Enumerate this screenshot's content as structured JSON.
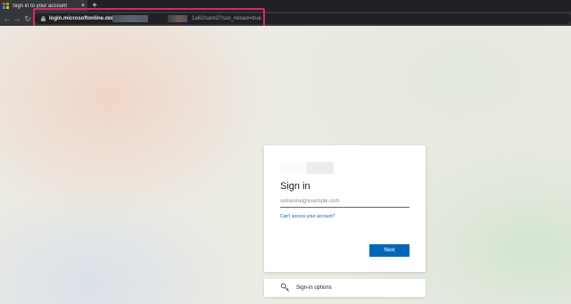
{
  "browser": {
    "tab_title": "Sign in to your account",
    "tab_close": "×",
    "new_tab": "+",
    "nav": {
      "back": "←",
      "forward": "→",
      "reload": "↻"
    },
    "url_host": "login.microsoftonline.com/",
    "url_path_start": "bc",
    "url_path_end": "1a62/saml2?sso_reload=true",
    "highlight_color": "#e0245e"
  },
  "signin": {
    "title": "Sign in",
    "email_placeholder": "someone@example.com",
    "help_link": "Can't access your account?",
    "next_label": "Next",
    "accent_color": "#0067b8"
  },
  "options": {
    "label": "Sign-in options",
    "icon": "key-icon"
  }
}
